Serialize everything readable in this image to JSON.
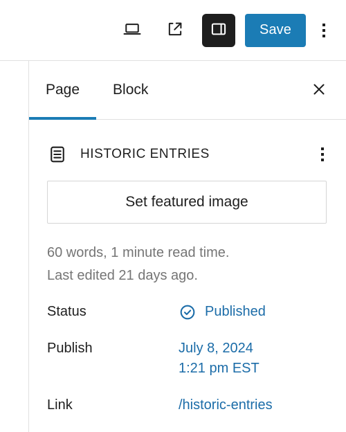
{
  "toolbar": {
    "device_preview_icon": "laptop-icon",
    "view_external_icon": "external-link-icon",
    "sidebar_toggle_icon": "sidebar-panel-icon",
    "save_label": "Save",
    "more_options_icon": "kebab-menu-icon"
  },
  "sidebar": {
    "tabs": [
      {
        "label": "Page",
        "active": true
      },
      {
        "label": "Block",
        "active": false
      }
    ],
    "close_icon": "close-x-icon",
    "document": {
      "icon": "document-page-icon",
      "title": "HISTORIC ENTRIES",
      "more_icon": "kebab-menu-icon"
    },
    "featured_image_label": "Set featured image",
    "meta": {
      "word_count": "60 words, 1 minute read time.",
      "last_edited": "Last edited 21 days ago."
    },
    "info_rows": [
      {
        "label": "Status",
        "value": "Published",
        "icon": "check-circle-icon",
        "second_line": ""
      },
      {
        "label": "Publish",
        "value": "July 8, 2024",
        "icon": "",
        "second_line": "1:21 pm EST"
      },
      {
        "label": "Link",
        "value": "/historic-entries",
        "icon": "",
        "second_line": ""
      }
    ]
  },
  "colors": {
    "accent_blue": "#1b7cb5",
    "link_blue": "#1b6ca8",
    "dark": "#1e1e1e",
    "muted_gray": "#757575",
    "border_gray": "#e0e0e0"
  }
}
